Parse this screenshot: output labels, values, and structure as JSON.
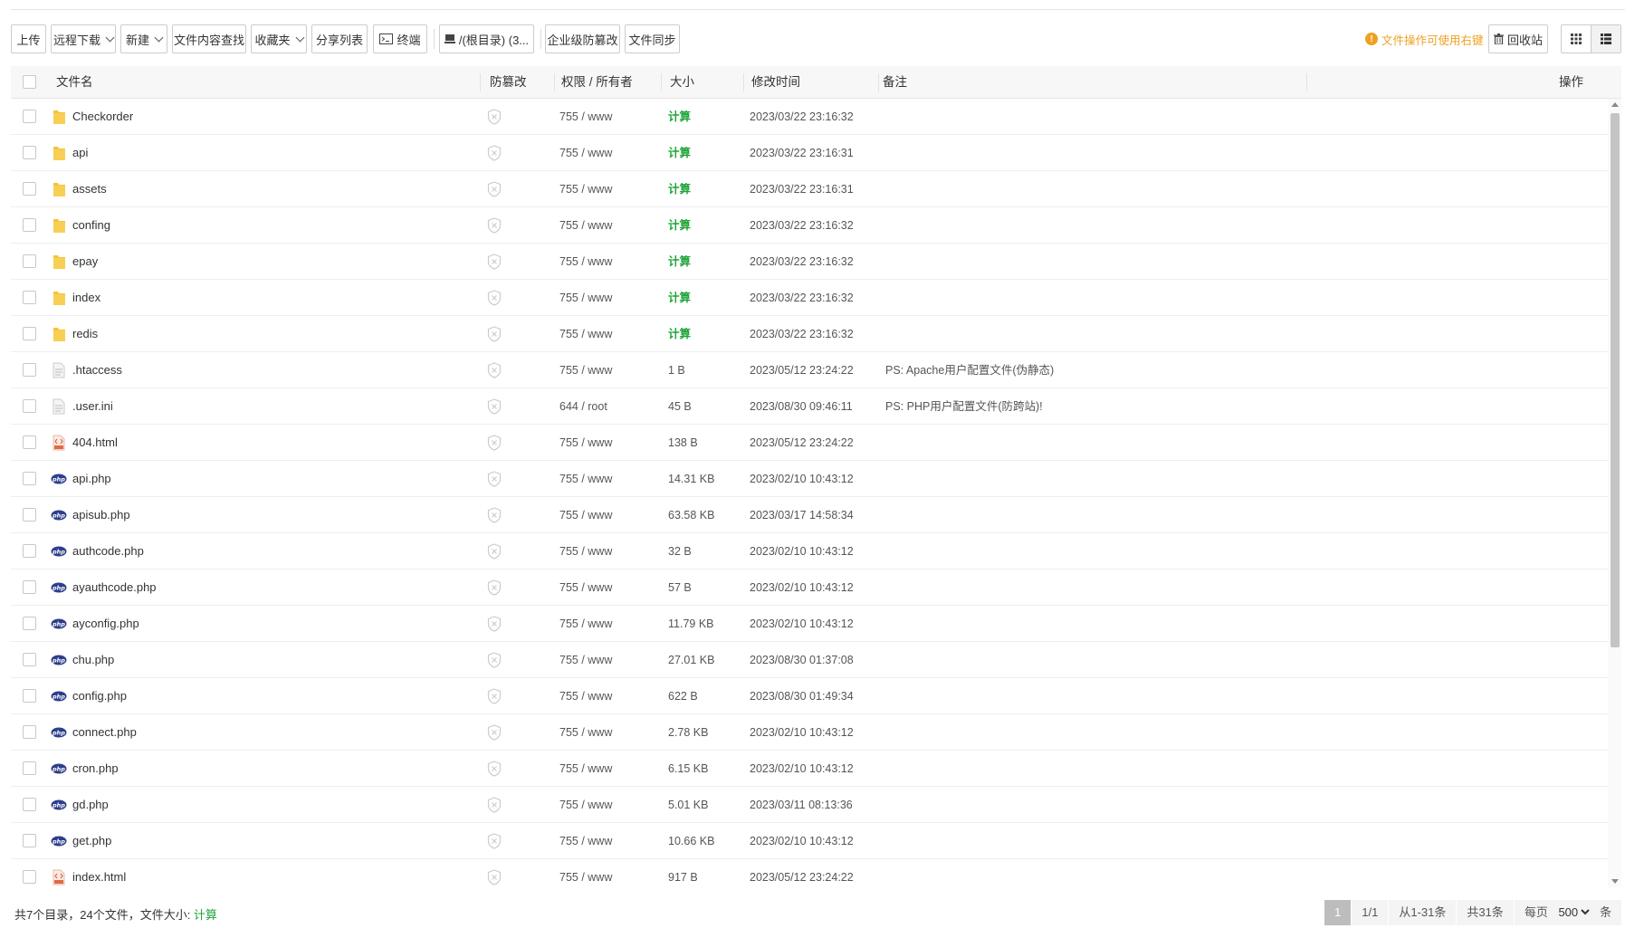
{
  "toolbar": {
    "upload": "上传",
    "remote_download": "远程下载",
    "new": "新建",
    "content_search": "文件内容查找",
    "favorites": "收藏夹",
    "share_list": "分享列表",
    "terminal": "终端",
    "path": "/(根目录) (3...",
    "tamper_proof": "企业级防篡改",
    "file_sync": "文件同步",
    "tip": "文件操作可使用右键",
    "recycle_bin": "回收站"
  },
  "columns": {
    "name": "文件名",
    "tamper": "防篡改",
    "perm_owner": "权限 / 所有者",
    "size": "大小",
    "mtime": "修改时间",
    "note": "备注",
    "actions": "操作"
  },
  "files": [
    {
      "name": "Checkorder",
      "type": "folder",
      "perm": "755 / www",
      "size": "计算",
      "mtime": "2023/03/22 23:16:32",
      "note": ""
    },
    {
      "name": "api",
      "type": "folder",
      "perm": "755 / www",
      "size": "计算",
      "mtime": "2023/03/22 23:16:31",
      "note": ""
    },
    {
      "name": "assets",
      "type": "folder",
      "perm": "755 / www",
      "size": "计算",
      "mtime": "2023/03/22 23:16:31",
      "note": ""
    },
    {
      "name": "confing",
      "type": "folder",
      "perm": "755 / www",
      "size": "计算",
      "mtime": "2023/03/22 23:16:32",
      "note": ""
    },
    {
      "name": "epay",
      "type": "folder",
      "perm": "755 / www",
      "size": "计算",
      "mtime": "2023/03/22 23:16:32",
      "note": ""
    },
    {
      "name": "index",
      "type": "folder",
      "perm": "755 / www",
      "size": "计算",
      "mtime": "2023/03/22 23:16:32",
      "note": ""
    },
    {
      "name": "redis",
      "type": "folder",
      "perm": "755 / www",
      "size": "计算",
      "mtime": "2023/03/22 23:16:32",
      "note": ""
    },
    {
      "name": ".htaccess",
      "type": "text",
      "perm": "755 / www",
      "size": "1 B",
      "mtime": "2023/05/12 23:24:22",
      "note": "PS: Apache用户配置文件(伪静态)"
    },
    {
      "name": ".user.ini",
      "type": "text",
      "perm": "644 / root",
      "size": "45 B",
      "mtime": "2023/08/30 09:46:11",
      "note": "PS: PHP用户配置文件(防跨站)!"
    },
    {
      "name": "404.html",
      "type": "html",
      "perm": "755 / www",
      "size": "138 B",
      "mtime": "2023/05/12 23:24:22",
      "note": ""
    },
    {
      "name": "api.php",
      "type": "php",
      "perm": "755 / www",
      "size": "14.31 KB",
      "mtime": "2023/02/10 10:43:12",
      "note": ""
    },
    {
      "name": "apisub.php",
      "type": "php",
      "perm": "755 / www",
      "size": "63.58 KB",
      "mtime": "2023/03/17 14:58:34",
      "note": ""
    },
    {
      "name": "authcode.php",
      "type": "php",
      "perm": "755 / www",
      "size": "32 B",
      "mtime": "2023/02/10 10:43:12",
      "note": ""
    },
    {
      "name": "ayauthcode.php",
      "type": "php",
      "perm": "755 / www",
      "size": "57 B",
      "mtime": "2023/02/10 10:43:12",
      "note": ""
    },
    {
      "name": "ayconfig.php",
      "type": "php",
      "perm": "755 / www",
      "size": "11.79 KB",
      "mtime": "2023/02/10 10:43:12",
      "note": ""
    },
    {
      "name": "chu.php",
      "type": "php",
      "perm": "755 / www",
      "size": "27.01 KB",
      "mtime": "2023/08/30 01:37:08",
      "note": ""
    },
    {
      "name": "config.php",
      "type": "php",
      "perm": "755 / www",
      "size": "622 B",
      "mtime": "2023/08/30 01:49:34",
      "note": ""
    },
    {
      "name": "connect.php",
      "type": "php",
      "perm": "755 / www",
      "size": "2.78 KB",
      "mtime": "2023/02/10 10:43:12",
      "note": ""
    },
    {
      "name": "cron.php",
      "type": "php",
      "perm": "755 / www",
      "size": "6.15 KB",
      "mtime": "2023/02/10 10:43:12",
      "note": ""
    },
    {
      "name": "gd.php",
      "type": "php",
      "perm": "755 / www",
      "size": "5.01 KB",
      "mtime": "2023/03/11 08:13:36",
      "note": ""
    },
    {
      "name": "get.php",
      "type": "php",
      "perm": "755 / www",
      "size": "10.66 KB",
      "mtime": "2023/02/10 10:43:12",
      "note": ""
    },
    {
      "name": "index.html",
      "type": "html",
      "perm": "755 / www",
      "size": "917 B",
      "mtime": "2023/05/12 23:24:22",
      "note": ""
    }
  ],
  "footer": {
    "summary_prefix": "共7个目录，24个文件，文件大小: ",
    "summary_calc": "计算",
    "page_current": "1",
    "page_total": "1/1",
    "range": "从1-31条",
    "total": "共31条",
    "per_page_label": "每页",
    "per_page_value": "500",
    "per_page_suffix": "条"
  },
  "colors": {
    "accent_green": "#20a53a",
    "tip_orange": "#f0a020",
    "folder_yellow": "#f5c33b",
    "php_blue": "#2d3e8c"
  }
}
